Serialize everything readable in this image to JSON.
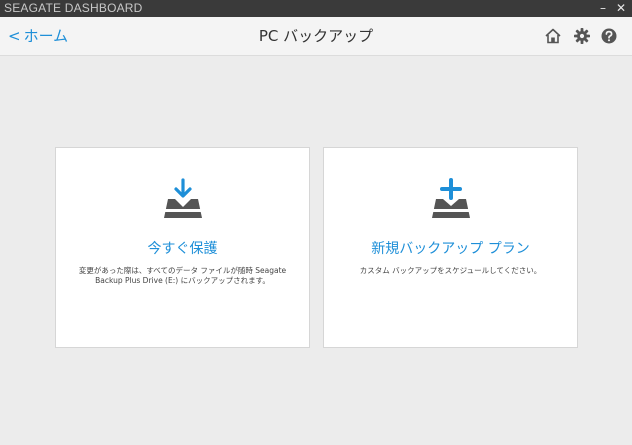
{
  "window": {
    "app_title": "SEAGATE DASHBOARD",
    "minimize_glyph": "–",
    "close_glyph": "✕"
  },
  "navbar": {
    "back_chevron": "<",
    "back_label": "ホーム",
    "page_title": "PC バックアップ",
    "icons": [
      "home-icon",
      "gear-icon",
      "help-icon"
    ]
  },
  "cards": [
    {
      "icon": "download-drive-icon",
      "title": "今すぐ保護",
      "description": "変更があった際は、すべてのデータ ファイルが随時 Seagate Backup Plus Drive (E:) にバックアップされます。"
    },
    {
      "icon": "add-drive-icon",
      "title": "新規バックアップ プラン",
      "description": "カスタム バックアップをスケジュールしてください。"
    }
  ],
  "colors": {
    "accent": "#1e8fd8",
    "titlebar": "#3a3a3a",
    "background": "#ececec",
    "icon_dark": "#555555"
  }
}
